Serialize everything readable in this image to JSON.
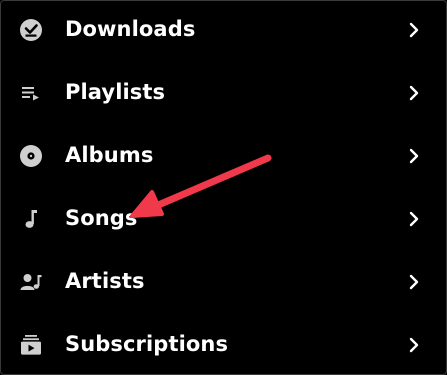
{
  "menu": {
    "items": [
      {
        "label": "Downloads",
        "icon": "download-check-icon"
      },
      {
        "label": "Playlists",
        "icon": "playlist-icon"
      },
      {
        "label": "Albums",
        "icon": "album-disc-icon"
      },
      {
        "label": "Songs",
        "icon": "music-note-icon"
      },
      {
        "label": "Artists",
        "icon": "artist-icon"
      },
      {
        "label": "Subscriptions",
        "icon": "subscriptions-icon"
      }
    ]
  },
  "colors": {
    "background": "#000000",
    "text": "#ffffff",
    "icon": "#cfcfcf",
    "annotation_arrow": "#f0394a"
  }
}
